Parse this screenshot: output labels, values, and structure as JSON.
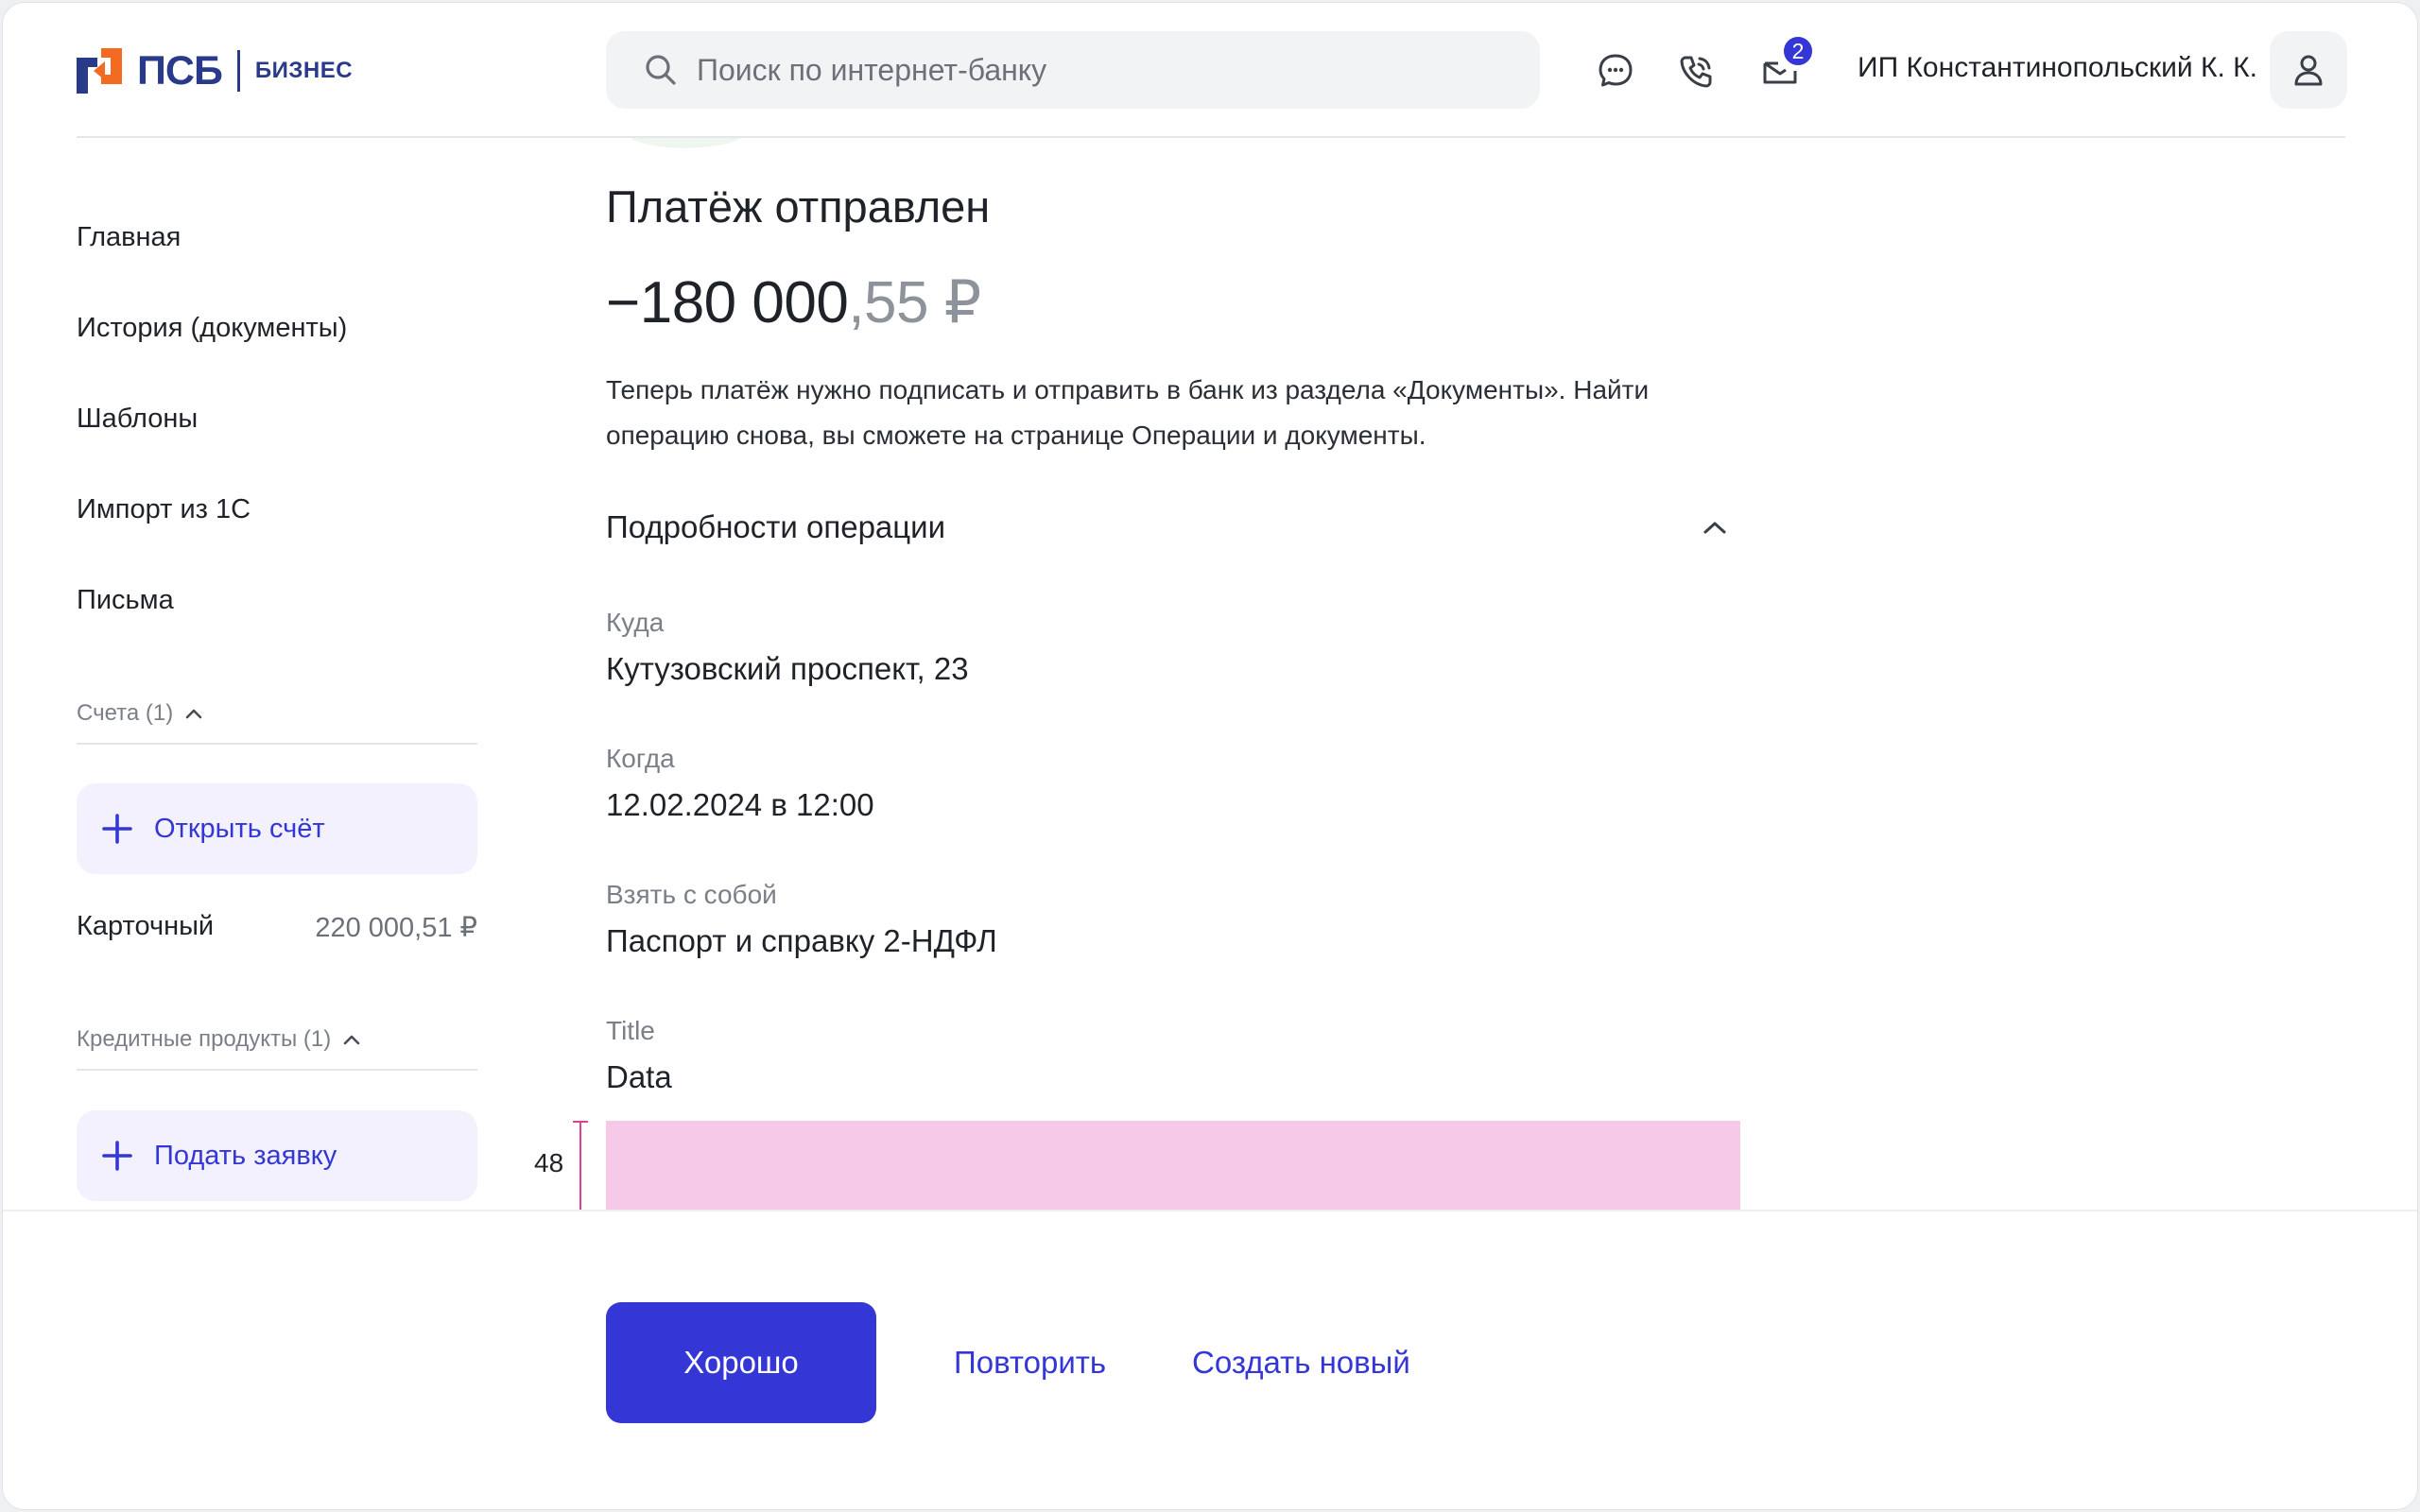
{
  "brand": {
    "name": "ПСБ",
    "sub": "БИЗНЕС"
  },
  "header": {
    "search_placeholder": "Поиск по интернет-банку",
    "notifications_count": "2",
    "user_name": "ИП Константинопольский К. К."
  },
  "sidebar": {
    "items": [
      {
        "label": "Главная"
      },
      {
        "label": "История (документы)"
      },
      {
        "label": "Шаблоны"
      },
      {
        "label": "Импорт из 1С"
      },
      {
        "label": "Письма"
      }
    ],
    "accounts": {
      "title": "Счета (1)",
      "open_label": "Открыть счёт",
      "list": [
        {
          "name": "Карточный",
          "amount": "220 000,51 ₽"
        }
      ]
    },
    "credit": {
      "title": "Кредитные продукты (1)",
      "apply_label": "Подать заявку"
    }
  },
  "main": {
    "title": "Платёж отправлен",
    "amount_int": "−180 000",
    "amount_frac": ",55 ₽",
    "description": "Теперь платёж нужно подписать и отправить в банк из раздела «Документы». Найти операцию снова, вы сможете на странице Операции и документы.",
    "details_title": "Подробности операции",
    "fields": [
      {
        "label": "Куда",
        "value": "Кутузовский проспект, 23"
      },
      {
        "label": "Когда",
        "value": "12.02.2024 в 12:00"
      },
      {
        "label": "Взять с собой",
        "value": "Паспорт и справку 2-НДФЛ"
      },
      {
        "label": "Title",
        "value": "Data"
      }
    ],
    "spacer_label": "48"
  },
  "footer": {
    "ok_label": "Хорошо",
    "repeat_label": "Повторить",
    "create_label": "Создать новый"
  },
  "colors": {
    "accent": "#3437d6",
    "brand": "#2a3a8a",
    "logo_orange": "#f26b21",
    "spacer": "#f6c9e8"
  }
}
